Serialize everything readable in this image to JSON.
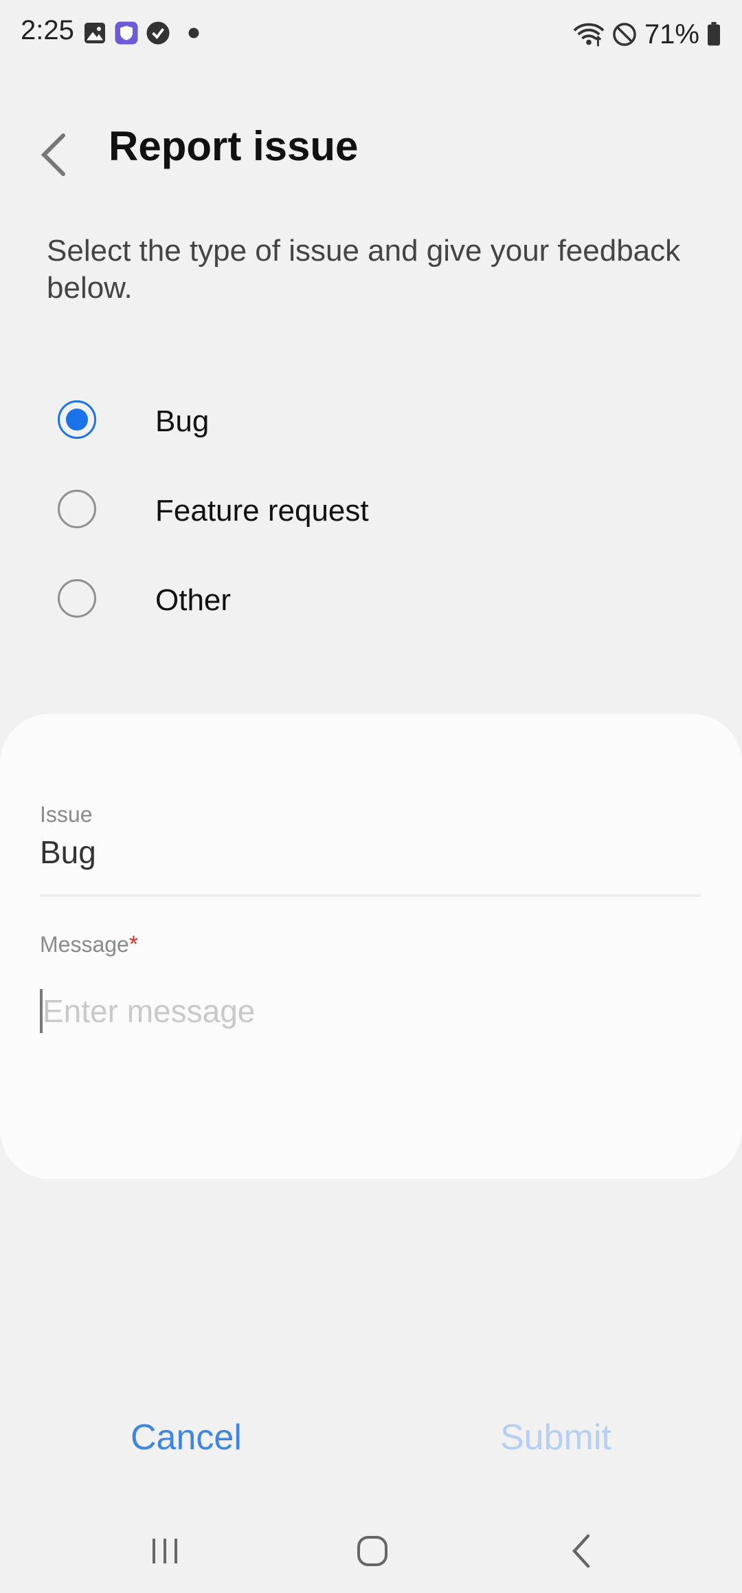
{
  "status_bar": {
    "time": "2:25",
    "battery": "71%",
    "icons": [
      "image-icon",
      "shield-icon",
      "check-circle-icon",
      "dot-icon",
      "wifi-icon",
      "dnd-icon",
      "battery-icon"
    ]
  },
  "header": {
    "title": "Report issue",
    "back_icon": "chevron-left-icon"
  },
  "description": "Select the type of issue and give your feedback below.",
  "issue_types": [
    {
      "label": "Bug",
      "checked": true
    },
    {
      "label": "Feature request",
      "checked": false
    },
    {
      "label": "Other",
      "checked": false
    }
  ],
  "form": {
    "issue_label": "Issue",
    "issue_value": "Bug",
    "message_label": "Message",
    "required_mark": "*",
    "message_placeholder": "Enter message",
    "message_value": ""
  },
  "actions": {
    "cancel": "Cancel",
    "submit": "Submit"
  },
  "nav": {
    "icons": [
      "recents-icon",
      "home-icon",
      "back-icon"
    ]
  },
  "colors": {
    "accent": "#1a73e8",
    "button_text": "#3f86e0",
    "disabled_button": "#b5cff1",
    "required": "#d93025"
  }
}
